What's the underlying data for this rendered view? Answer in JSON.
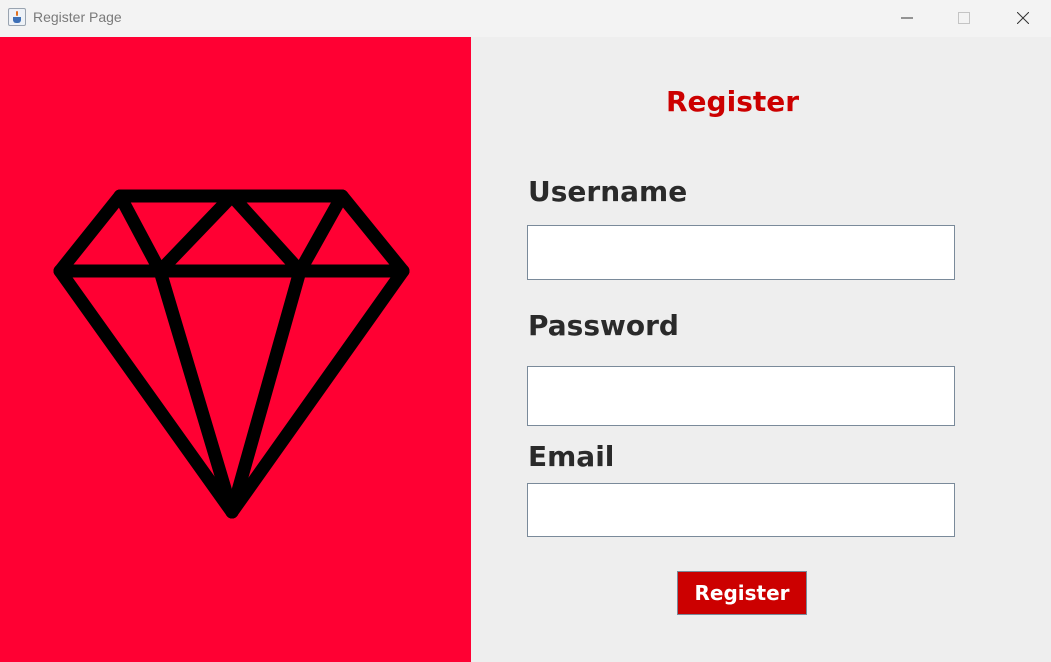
{
  "window": {
    "title": "Register Page",
    "icon": "java-cup-icon",
    "controls": [
      "minimize-icon",
      "maximize-icon",
      "close-icon"
    ]
  },
  "brand_panel": {
    "background_color": "#ff0033",
    "graphic": "diamond-icon"
  },
  "form": {
    "title": "Register",
    "title_color": "#cc0000",
    "username_label": "Username",
    "username_value": "",
    "password_label": "Password",
    "password_value": "",
    "email_label": "Email",
    "email_value": "",
    "submit_label": "Register",
    "submit_color": "#cc0000"
  }
}
